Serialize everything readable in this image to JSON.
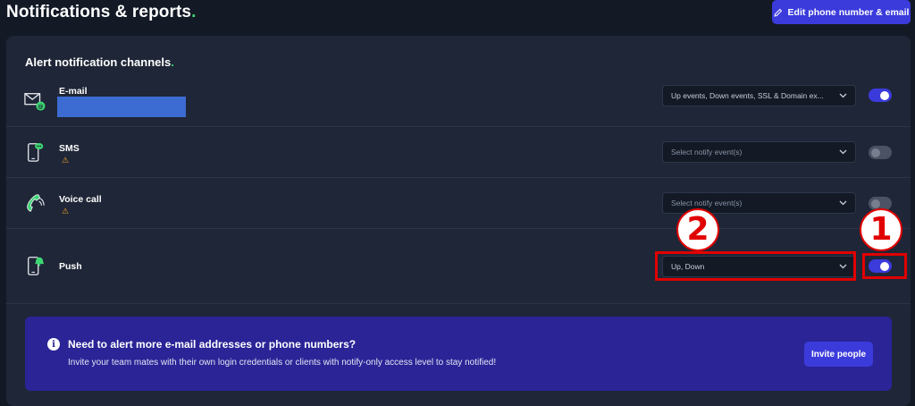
{
  "header": {
    "title": "Notifications & reports",
    "title_dot": ".",
    "edit_button_label": "Edit phone number & email"
  },
  "section": {
    "title": "Alert notification channels",
    "title_dot": "."
  },
  "channels": [
    {
      "label": "E-mail",
      "icon": "email-icon",
      "select_value": "Up events, Down events, SSL & Domain ex...",
      "enabled": true
    },
    {
      "label": "SMS",
      "icon": "sms-phone-icon",
      "warning_icon": "warning-icon",
      "warning": "⚠",
      "select_value": "Select notify event(s)",
      "enabled": false
    },
    {
      "label": "Voice call",
      "icon": "voice-call-icon",
      "warning_icon": "warning-icon",
      "warning": "⚠",
      "select_value": "Select notify event(s)",
      "enabled": false
    },
    {
      "label": "Push",
      "icon": "push-device-icon",
      "select_value": "Up, Down",
      "enabled": true
    }
  ],
  "annotations": [
    {
      "number": "1",
      "target": "push-toggle"
    },
    {
      "number": "2",
      "target": "push-event-select"
    }
  ],
  "banner": {
    "title": "Need to alert more e-mail addresses or phone numbers?",
    "text": "Invite your team mates with their own login credentials or clients with notify-only access level to stay notified!",
    "button_label": "Invite people",
    "info_icon_glyph": "i"
  },
  "colors": {
    "background": "#131a26",
    "card": "#1f2637",
    "accent": "#3b3bdc",
    "banner": "#2a2497",
    "green": "#3bd671",
    "warning": "#f5a623",
    "annotation_red": "#e10000"
  }
}
